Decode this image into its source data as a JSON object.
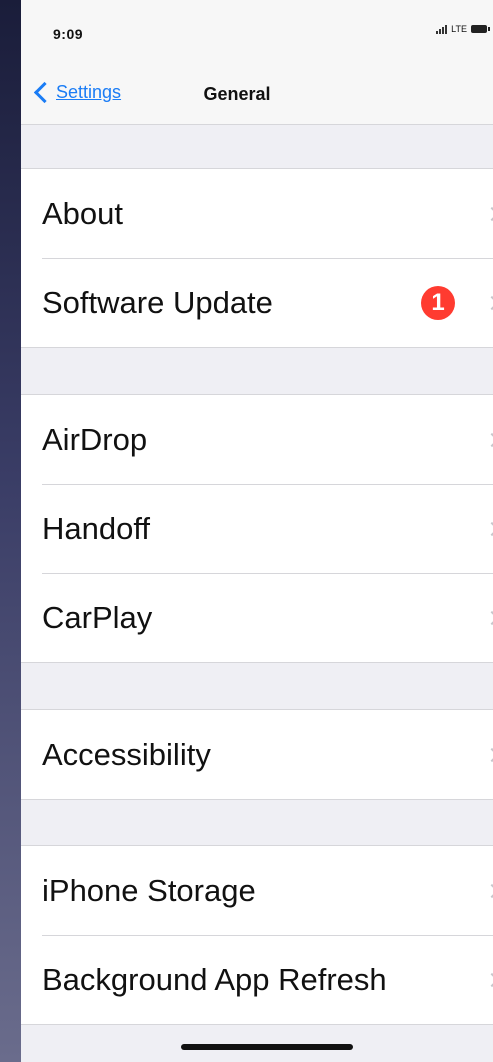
{
  "status_bar": {
    "time": "9:09",
    "network": "LTE"
  },
  "nav": {
    "back_label": "Settings",
    "title": "General"
  },
  "groups": [
    {
      "rows": [
        {
          "label": "About"
        },
        {
          "label": "Software Update",
          "badge": "1"
        }
      ]
    },
    {
      "rows": [
        {
          "label": "AirDrop"
        },
        {
          "label": "Handoff"
        },
        {
          "label": "CarPlay"
        }
      ]
    },
    {
      "rows": [
        {
          "label": "Accessibility"
        }
      ]
    },
    {
      "rows": [
        {
          "label": "iPhone Storage"
        },
        {
          "label": "Background App Refresh"
        }
      ]
    }
  ],
  "colors": {
    "accent": "#1a7cf5",
    "badge": "#ff3b30",
    "background": "#efeff4"
  }
}
